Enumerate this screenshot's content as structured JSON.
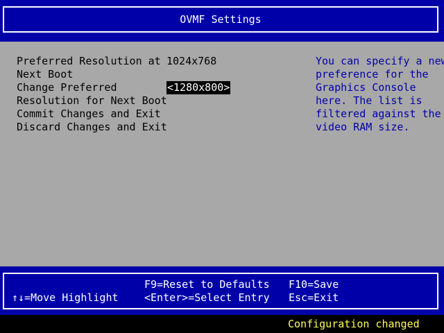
{
  "header": {
    "title": "OVMF Settings"
  },
  "menu": {
    "preferred_resolution": {
      "label_line1": "Preferred Resolution at",
      "label_line2": "Next Boot",
      "value": "1024x768"
    },
    "change_preferred": {
      "label_line1": "Change Preferred",
      "label_line2": "Resolution for Next Boot",
      "value": "<1280x800>"
    },
    "commit_changes": {
      "label": "Commit Changes and Exit"
    },
    "discard_changes": {
      "label": "Discard Changes and Exit"
    }
  },
  "help": {
    "lines": [
      "You can specify a new",
      "preference for the",
      "Graphics Console",
      "here. The list is",
      "filtered against the",
      "video RAM size."
    ]
  },
  "footer": {
    "f9_hint": "F9=Reset to Defaults",
    "f10_hint": "F10=Save",
    "move_hint": "↑↓=Move Highlight",
    "enter_hint": "<Enter>=Select Entry",
    "esc_hint": "Esc=Exit"
  },
  "status": {
    "message": "Configuration changed"
  },
  "colors": {
    "header_blue": "#0000a8",
    "panel_gray": "#a8a8a8",
    "help_text_blue": "#0000a8",
    "status_yellow": "#ffff54",
    "highlight_black": "#000000"
  }
}
